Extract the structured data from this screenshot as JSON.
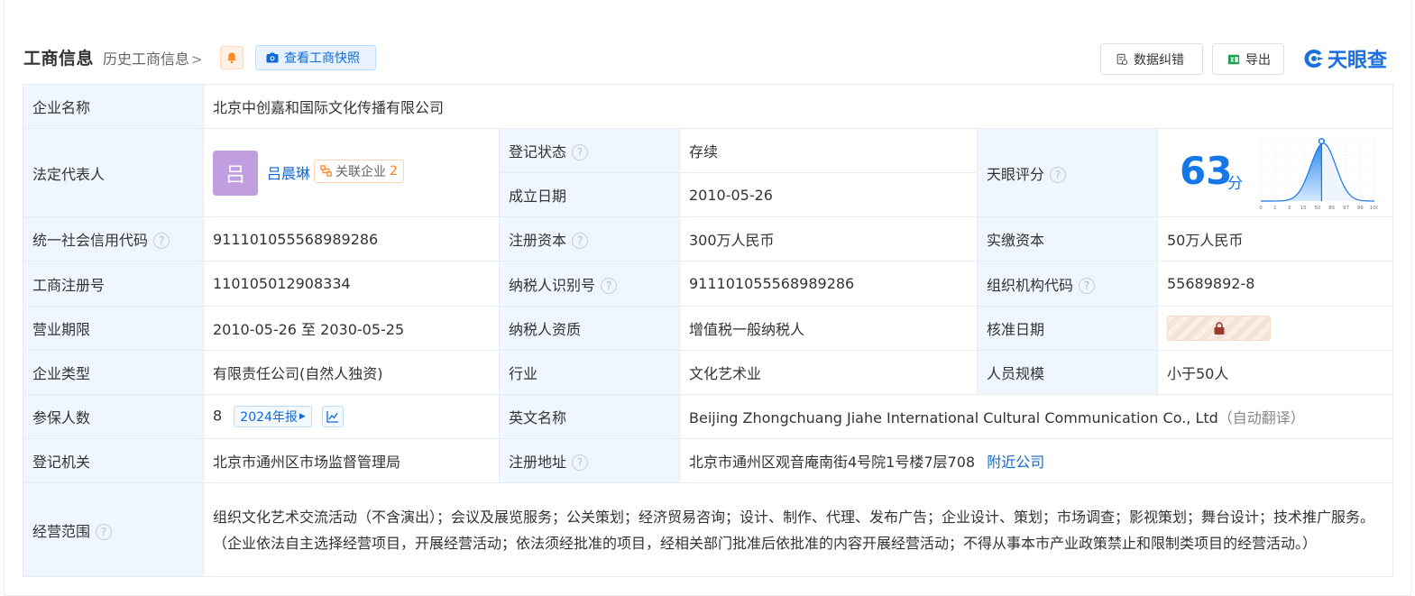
{
  "header": {
    "title": "工商信息",
    "history_link": "历史工商信息",
    "snapshot_button": "查看工商快照",
    "data_fix_button": "数据纠错",
    "export_button": "导出",
    "logo_text": "天眼查"
  },
  "rows": {
    "company_name": {
      "label": "企业名称",
      "value": "北京中创嘉和国际文化传播有限公司"
    },
    "legal_rep": {
      "label": "法定代表人",
      "avatar_char": "吕",
      "name": "吕晨琳",
      "related_label": "关联企业",
      "related_count": "2"
    },
    "reg_status": {
      "label": "登记状态",
      "value": "存续"
    },
    "found_date": {
      "label": "成立日期",
      "value": "2010-05-26"
    },
    "tianyan_score": {
      "label": "天眼评分",
      "score": "63",
      "unit": "分"
    },
    "credit_code": {
      "label": "统一社会信用代码",
      "value": "911101055568989286"
    },
    "reg_capital": {
      "label": "注册资本",
      "value": "300万人民币"
    },
    "paid_capital": {
      "label": "实缴资本",
      "value": "50万人民币"
    },
    "biz_reg_no": {
      "label": "工商注册号",
      "value": "110105012908334"
    },
    "taxpayer_id": {
      "label": "纳税人识别号",
      "value": "911101055568989286"
    },
    "org_code": {
      "label": "组织机构代码",
      "value": "55689892-8"
    },
    "biz_term": {
      "label": "营业期限",
      "value": "2010-05-26 至 2030-05-25"
    },
    "taxpayer_qual": {
      "label": "纳税人资质",
      "value": "增值税一般纳税人"
    },
    "approve_date": {
      "label": "核准日期"
    },
    "company_type": {
      "label": "企业类型",
      "value": "有限责任公司(自然人独资)"
    },
    "industry": {
      "label": "行业",
      "value": "文化艺术业"
    },
    "staff_size": {
      "label": "人员规模",
      "value": "小于50人"
    },
    "insured": {
      "label": "参保人数",
      "value": "8",
      "report_tag": "2024年报"
    },
    "english_name": {
      "label": "英文名称",
      "value": "Beijing Zhongchuang Jiahe International Cultural Communication Co., Ltd",
      "note": "（自动翻译）"
    },
    "reg_authority": {
      "label": "登记机关",
      "value": "北京市通州区市场监督管理局"
    },
    "reg_address": {
      "label": "注册地址",
      "value": "北京市通州区观音庵南街4号院1号楼7层708",
      "nearby_link": "附近公司"
    },
    "biz_scope": {
      "label": "经营范围",
      "value": "组织文化艺术交流活动（不含演出）；会议及展览服务；公关策划；经济贸易咨询；设计、制作、代理、发布广告；企业设计、策划；市场调查；影视策划；舞台设计；技术推广服务。（企业依法自主选择经营项目，开展经营活动；依法须经批准的项目，经相关部门批准后依批准的内容开展经营活动；不得从事本市产业政策禁止和限制类项目的经营活动。）"
    }
  },
  "score_chart": {
    "x_ticks": [
      "0",
      "1",
      "3",
      "15",
      "50",
      "85",
      "97",
      "99",
      "100"
    ],
    "marker": 63
  },
  "colors": {
    "accent": "#1677e8",
    "label_bg": "#f0f6ff",
    "status_green": "#1f9a4e"
  }
}
